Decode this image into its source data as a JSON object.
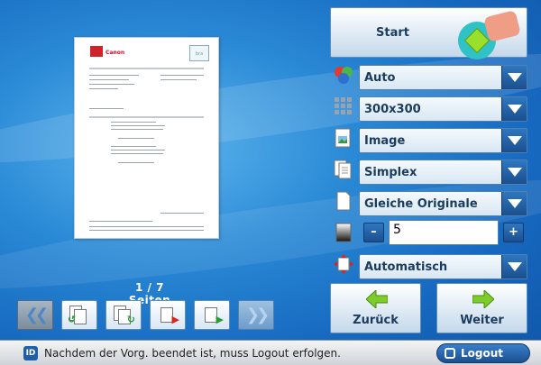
{
  "preview": {
    "logo_text": "Canon",
    "stamp_text": "bra"
  },
  "page_counter": "1 / 7 Seiten",
  "nav_buttons": [
    {
      "icon": "double-chevron-left-icon"
    },
    {
      "icon": "page-rotate-left-icon"
    },
    {
      "icon": "page-rotate-right-icon"
    },
    {
      "icon": "page-delete-icon"
    },
    {
      "icon": "page-insert-icon"
    },
    {
      "icon": "double-chevron-right-icon"
    }
  ],
  "start": {
    "label": "Start"
  },
  "settings": {
    "color": {
      "value": "Auto",
      "icon": "color-mode-icon"
    },
    "resolution": {
      "value": "300x300",
      "icon": "resolution-icon"
    },
    "document_type": {
      "value": "Image",
      "icon": "image-type-icon"
    },
    "sides": {
      "value": "Simplex",
      "icon": "simplex-icon"
    },
    "original_size": {
      "value": "Gleiche Originale",
      "icon": "original-size-icon"
    },
    "density": {
      "value": "5",
      "minus": "–",
      "plus": "+",
      "icon": "density-icon"
    },
    "orientation": {
      "value": "Automatisch",
      "icon": "orientation-icon"
    }
  },
  "back": {
    "label": "Zurück"
  },
  "next": {
    "label": "Weiter"
  },
  "status": {
    "id_badge": "ID",
    "message": "Nachdem der Vorg. beendet ist, muss Logout erfolgen.",
    "logout_label": "Logout"
  },
  "colors": {
    "accent": "#1b4f8e",
    "start_green": "#9adf2c",
    "background": "#2a8ad6"
  }
}
